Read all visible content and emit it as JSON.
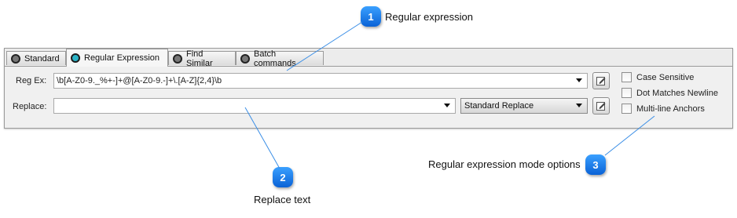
{
  "callouts": [
    {
      "number": "1",
      "text": "Regular expression"
    },
    {
      "number": "2",
      "text": "Replace text"
    },
    {
      "number": "3",
      "text": "Regular expression mode options"
    }
  ],
  "tabs": [
    {
      "label": "Standard",
      "active": false
    },
    {
      "label": "Regular Expression",
      "active": true
    },
    {
      "label": "Find Similar",
      "active": false
    },
    {
      "label": "Batch commands",
      "active": false
    }
  ],
  "form": {
    "regex_label": "Reg Ex:",
    "regex_value": "\\b[A-Z0-9._%+-]+@[A-Z0-9.-]+\\.[A-Z]{2,4}\\b",
    "replace_label": "Replace:",
    "replace_value": "",
    "replace_mode": "Standard Replace"
  },
  "options": [
    {
      "label": "Case Sensitive",
      "checked": false
    },
    {
      "label": "Dot Matches Newline",
      "checked": false
    },
    {
      "label": "Multi-line Anchors",
      "checked": false
    }
  ],
  "icons": {
    "edit": "pencil-edit-icon",
    "dropdown": "chevron-down-icon",
    "tab_radio": "radio-indicator-icon"
  },
  "colors": {
    "callout": "#1f7fe8",
    "active_radio": "#2bb3c6",
    "leader_line": "#3a8ee6"
  }
}
